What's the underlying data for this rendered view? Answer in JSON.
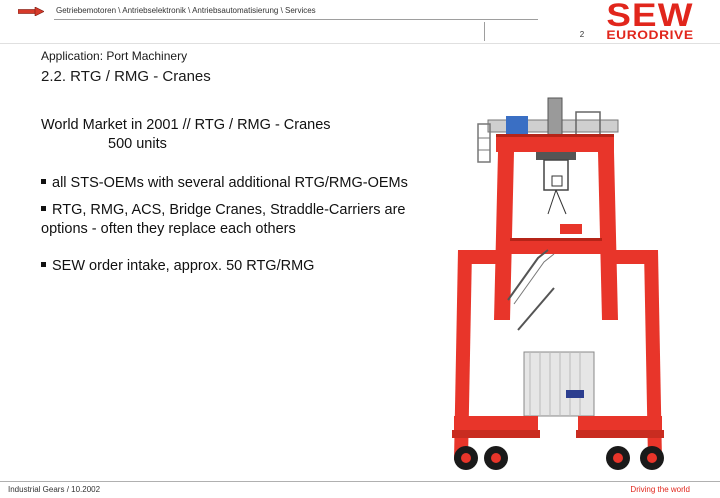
{
  "header": {
    "breadcrumb": "Getriebemotoren \\ Antriebselektronik \\ Antriebsautomatisierung \\ Services",
    "page_number": "2"
  },
  "logo": {
    "main": "SEW",
    "sub": "EURODRIVE"
  },
  "slide": {
    "section": "Application: Port Machinery",
    "title": "2.2. RTG / RMG - Cranes",
    "market_line": "World Market in 2001 //  RTG / RMG - Cranes",
    "units_line": "500 units",
    "bullets": [
      "all STS-OEMs with several additional RTG/RMG-OEMs",
      "RTG, RMG, ACS, Bridge Cranes, Straddle-Carriers are options - often they replace each others",
      "SEW order intake, approx. 50 RTG/RMG"
    ]
  },
  "footer": {
    "left": "Industrial Gears / 10.2002",
    "right": "Driving the world"
  },
  "colors": {
    "brand_red": "#e1261c",
    "crane_red": "#e8352a",
    "nav_arrow": "#d63a2a"
  },
  "icons": {
    "nav": "arrow-right-icon"
  }
}
